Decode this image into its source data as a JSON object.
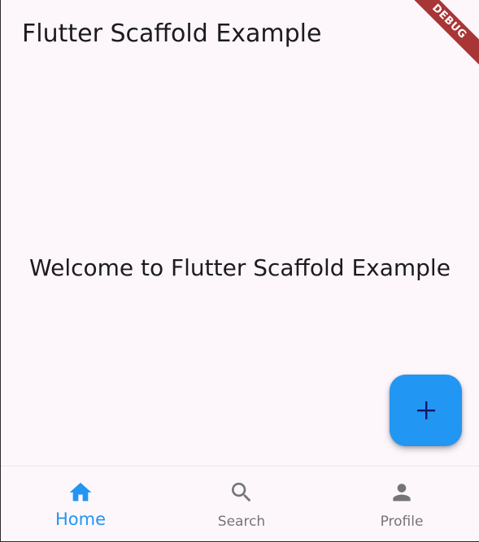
{
  "app_bar": {
    "title": "Flutter Scaffold Example"
  },
  "body": {
    "welcome_text": "Welcome to Flutter Scaffold Example"
  },
  "fab": {
    "icon": "add-icon"
  },
  "bottom_nav": {
    "selected_index": 0,
    "items": [
      {
        "label": "Home",
        "icon": "home-icon"
      },
      {
        "label": "Search",
        "icon": "search-icon"
      },
      {
        "label": "Profile",
        "icon": "person-icon"
      }
    ]
  },
  "debug_banner": {
    "label": "DEBUG"
  },
  "colors": {
    "background": "#fdf7fc",
    "accent": "#2196f3",
    "inactive": "#757575",
    "text": "#1d1b20",
    "fab_icon": "#1b1464",
    "banner": "#a93636"
  }
}
